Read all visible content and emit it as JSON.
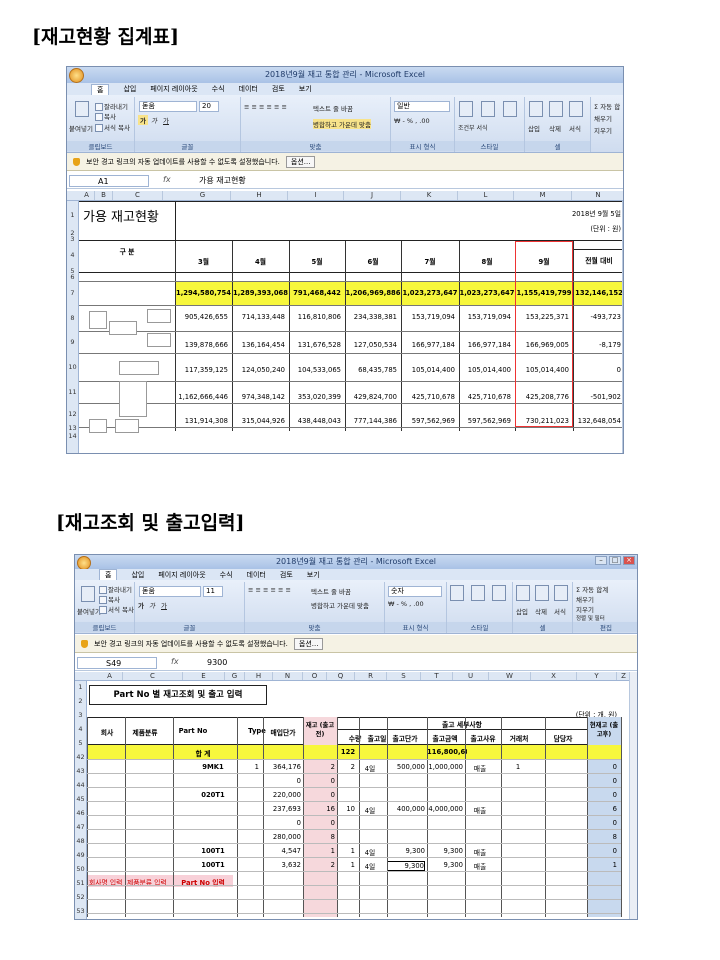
{
  "section1_title": "[재고현황 집계표]",
  "section2_title": "[재고조회 및 출고입력]",
  "win1": {
    "title": "2018년9월 재고 통합 관리 - Microsoft Excel",
    "tabs": [
      "홈",
      "삽입",
      "페이지 레이아웃",
      "수식",
      "데이터",
      "검토",
      "보기"
    ],
    "clipboard": {
      "paste": "붙여넣기",
      "cut": "잘라내기",
      "copy": "복사",
      "format": "서식 복사",
      "label": "클립보드"
    },
    "font": {
      "name": "돋움",
      "size": "20",
      "label": "글꼴"
    },
    "align": {
      "wrap": "텍스트 줄 바꿈",
      "merge": "병합하고 가운데 맞춤",
      "label": "맞춤"
    },
    "number": {
      "format": "일반",
      "label": "표시 형식"
    },
    "styles": {
      "cond": "조건부 서식",
      "table": "표 서식",
      "cell": "셀 스타일",
      "label": "스타일"
    },
    "cells": {
      "insert": "삽입",
      "delete": "삭제",
      "format": "서식",
      "label": "셀"
    },
    "editing": {
      "autosum": "자동 합",
      "fill": "채우기",
      "clear": "지우기"
    },
    "warning": "보안 경고   링크의 자동 업데이트를 사용할 수 없도록 설정했습니다.",
    "option_btn": "옵션...",
    "cell_ref": "A1",
    "formula": "가용 재고현황",
    "col_headers": [
      "A",
      "B",
      "C",
      "G",
      "H",
      "I",
      "J",
      "K",
      "L",
      "M",
      "N"
    ],
    "row_headers": [
      "1",
      "2",
      "3",
      "4",
      "5",
      "6",
      "7",
      "8",
      "9",
      "10",
      "11",
      "12",
      "13",
      "14"
    ],
    "sheet_title": "가용 재고현황",
    "date": "2018년 9월 5일",
    "unit": "(단위 : 원)",
    "gubun": "구 분",
    "months": [
      "3월",
      "4월",
      "5월",
      "6월",
      "7월",
      "8월",
      "9월"
    ],
    "prev_compare": "전월 대비",
    "totals": [
      "1,294,580,754",
      "1,289,393,068",
      "791,468,442",
      "1,206,969,886",
      "1,023,273,647",
      "1,023,273,647",
      "1,155,419,799",
      "132,146,152"
    ],
    "rows": [
      [
        "905,426,655",
        "714,133,448",
        "116,810,806",
        "234,338,381",
        "153,719,094",
        "153,719,094",
        "153,225,371",
        "-493,723"
      ],
      [
        "139,878,666",
        "136,164,454",
        "131,676,528",
        "127,050,534",
        "166,977,184",
        "166,977,184",
        "166,969,005",
        "-8,179"
      ],
      [
        "117,359,125",
        "124,050,240",
        "104,533,065",
        "68,435,785",
        "105,014,400",
        "105,014,400",
        "105,014,400",
        "0"
      ],
      [
        "1,162,666,446",
        "974,348,142",
        "353,020,399",
        "429,824,700",
        "425,710,678",
        "425,710,678",
        "425,208,776",
        "-501,902"
      ],
      [
        "131,914,308",
        "315,044,926",
        "438,448,043",
        "777,144,386",
        "597,562,969",
        "597,562,969",
        "730,211,023",
        "132,648,054"
      ]
    ]
  },
  "win2": {
    "title": "2018년9월 재고 통합 관리 - Microsoft Excel",
    "tabs": [
      "홈",
      "삽입",
      "페이지 레이아웃",
      "수식",
      "데이터",
      "검토",
      "보기"
    ],
    "clipboard": {
      "paste": "붙여넣기",
      "cut": "잘라내기",
      "copy": "복사",
      "format": "서식 복사",
      "label": "클립보드"
    },
    "font": {
      "name": "돋움",
      "size": "11",
      "label": "글꼴"
    },
    "align": {
      "wrap": "텍스트 줄 바꿈",
      "merge": "병합하고 가운데 맞춤",
      "label": "맞춤"
    },
    "number": {
      "format": "숫자",
      "label": "표시 형식"
    },
    "styles": {
      "cond": "조건부 서식",
      "table": "표 서식",
      "cell": "셀 스타일",
      "label": "스타일"
    },
    "cells": {
      "insert": "삽입",
      "delete": "삭제",
      "format": "서식",
      "label": "셀"
    },
    "editing": {
      "autosum": "자동 합계",
      "fill": "채우기",
      "clear": "지우기",
      "sort": "정렬 및 필터",
      "find": "찾기 및 선택",
      "label": "편집"
    },
    "warning": "보안 경고   링크의 자동 업데이트를 사용할 수 없도록 설정했습니다.",
    "option_btn": "옵션...",
    "cell_ref": "S49",
    "formula": "9300",
    "col_headers": [
      "A",
      "C",
      "E",
      "G",
      "H",
      "N",
      "O",
      "Q",
      "R",
      "S",
      "T",
      "U",
      "W",
      "X",
      "Y",
      "Z"
    ],
    "row_headers": [
      "1",
      "2",
      "3",
      "4",
      "5",
      "42",
      "43",
      "44",
      "45",
      "46",
      "47",
      "48",
      "49",
      "50",
      "51",
      "52",
      "53"
    ],
    "sheet_title": "Part No 별 재고조회 및 출고 입력",
    "unit": "(단위 : 개, 원)",
    "headers": {
      "company": "회사",
      "product": "제품분류",
      "partno": "Part No",
      "type": "Type",
      "price": "매입단가",
      "stock": "재고 (출고전)",
      "detail": "출고 세부사항",
      "qty": "수량",
      "date": "출고일",
      "unitprice": "출고단가",
      "amount": "출고금액",
      "reason": "출고사유",
      "client": "거래처",
      "manager": "담당자",
      "current": "현재고 (출고후)"
    },
    "sum_label": "합 계",
    "sum_qty": "122",
    "sum_amount": "116,800,600",
    "rows": [
      {
        "part": "9MK1",
        "type": "1",
        "price": "364,176",
        "stock": "2",
        "qty": "2",
        "date": "4일",
        "unit": "500,000",
        "amount": "1,000,000",
        "reason": "매출",
        "client": "1",
        "cur": "0"
      },
      {
        "part": "",
        "type": "",
        "price": "0",
        "stock": "0",
        "qty": "",
        "date": "",
        "unit": "",
        "amount": "",
        "reason": "",
        "client": "",
        "cur": "0"
      },
      {
        "part": "020T1",
        "type": "",
        "price": "220,000",
        "stock": "0",
        "qty": "",
        "date": "",
        "unit": "",
        "amount": "",
        "reason": "",
        "client": "",
        "cur": "0"
      },
      {
        "part": "",
        "type": "",
        "price": "237,693",
        "stock": "16",
        "qty": "10",
        "date": "4일",
        "unit": "400,000",
        "amount": "4,000,000",
        "reason": "매출",
        "client": "",
        "cur": "6"
      },
      {
        "part": "",
        "type": "",
        "price": "0",
        "stock": "0",
        "qty": "",
        "date": "",
        "unit": "",
        "amount": "",
        "reason": "",
        "client": "",
        "cur": "0"
      },
      {
        "part": "",
        "type": "",
        "price": "280,000",
        "stock": "8",
        "qty": "",
        "date": "",
        "unit": "",
        "amount": "",
        "reason": "",
        "client": "",
        "cur": "8"
      },
      {
        "part": "100T1",
        "type": "",
        "price": "4,547",
        "stock": "1",
        "qty": "1",
        "date": "4일",
        "unit": "9,300",
        "amount": "9,300",
        "reason": "매출",
        "client": "",
        "cur": "0"
      },
      {
        "part": "100T1",
        "type": "",
        "price": "3,632",
        "stock": "2",
        "qty": "1",
        "date": "4일",
        "unit": "9,300",
        "amount": "9,300",
        "reason": "매출",
        "client": "",
        "cur": "1"
      }
    ],
    "input_labels": {
      "company": "회사명 입력",
      "product": "제품분류 입력",
      "partno": "Part No 입력"
    }
  }
}
